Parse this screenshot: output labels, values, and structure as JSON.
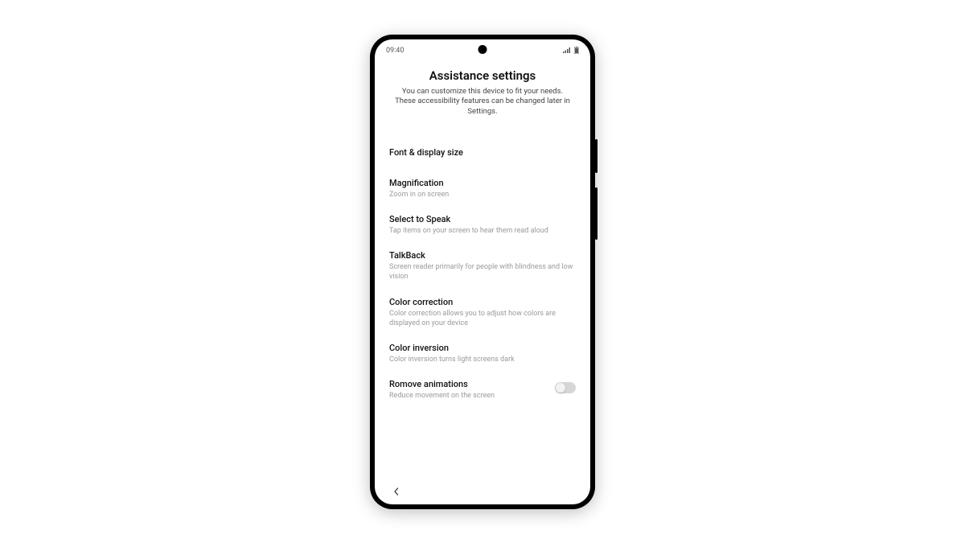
{
  "status": {
    "time": "09:40"
  },
  "page": {
    "title": "Assistance settings",
    "subtitle": "You can customize this device to fit your needs. These accessibility features can be changed later in Settings."
  },
  "settings": [
    {
      "title": "Font & display size",
      "desc": "",
      "toggle": false
    },
    {
      "title": "Magnification",
      "desc": "Zoom in on screen",
      "toggle": false
    },
    {
      "title": "Select to Speak",
      "desc": "Tap items on your screen to hear them read aloud",
      "toggle": false
    },
    {
      "title": "TalkBack",
      "desc": "Screen reader primarily for people with blindness and low vision",
      "toggle": false
    },
    {
      "title": "Color correction",
      "desc": "Color correction allows you to adjust how colors are displayed on your device",
      "toggle": false
    },
    {
      "title": "Color inversion",
      "desc": "Color inversion turns light screens dark",
      "toggle": false
    },
    {
      "title": "Romove animations",
      "desc": "Reduce movement on the screen",
      "toggle": true
    }
  ]
}
